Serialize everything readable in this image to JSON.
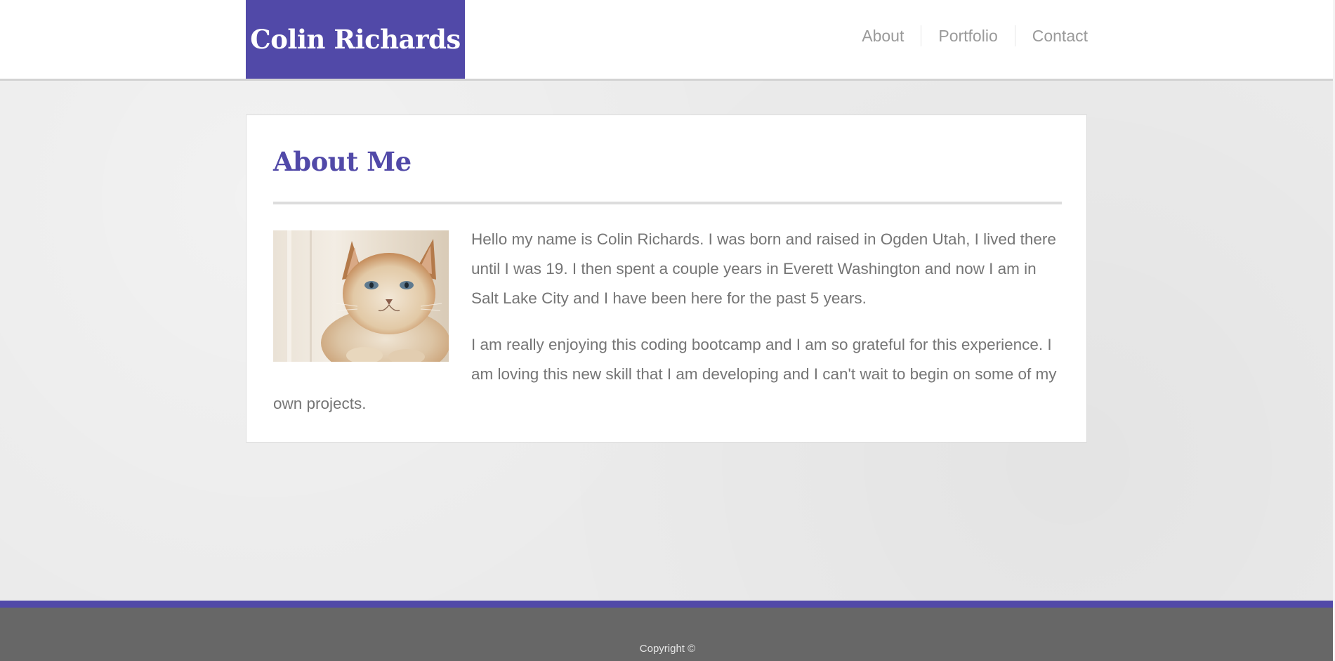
{
  "header": {
    "brand": "Colin Richards",
    "nav": [
      "About",
      "Portfolio",
      "Contact"
    ]
  },
  "main": {
    "title": "About Me",
    "image_alt": "cat-photo",
    "paragraphs": [
      "Hello my name is Colin Richards. I was born and raised in Ogden Utah, I lived there until I was 19. I then spent a couple years in Everett Washington and now I am in Salt Lake City and I have been here for the past 5 years.",
      "I am really enjoying this coding bootcamp and I am so grateful for this experience. I am loving this new skill that I am developing and I can't wait to begin on some of my own projects."
    ]
  },
  "footer": {
    "copyright": "Copyright ©"
  },
  "colors": {
    "accent": "#5149a8",
    "footer": "#676767",
    "background": "#ebebeb",
    "text": "#757575"
  }
}
